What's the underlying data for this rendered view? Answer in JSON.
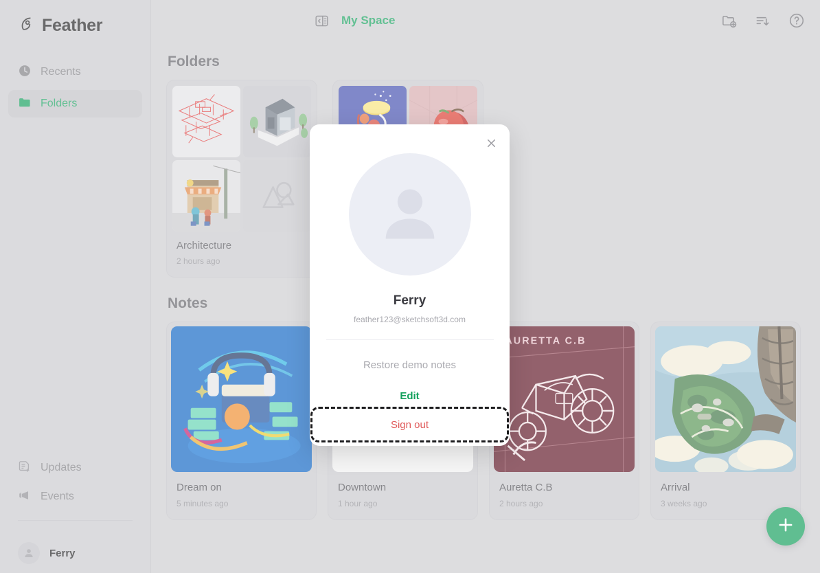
{
  "brand": {
    "name": "Feather",
    "logo_icon": "feather-icon"
  },
  "sidebar": {
    "items": [
      {
        "label": "Recents",
        "icon": "clock-icon",
        "active": false
      },
      {
        "label": "Folders",
        "icon": "folder-icon",
        "active": true
      }
    ],
    "bottom_items": [
      {
        "label": "Updates",
        "icon": "note-plus-icon"
      },
      {
        "label": "Events",
        "icon": "megaphone-icon"
      }
    ],
    "user": {
      "name": "Ferry",
      "avatar_icon": "person-icon"
    }
  },
  "topbar": {
    "collapse_icon": "panel-collapse-icon",
    "space_title": "My Space",
    "actions": [
      {
        "icon": "new-folder-icon",
        "name": "new-folder-button"
      },
      {
        "icon": "sort-icon",
        "name": "sort-button"
      },
      {
        "icon": "help-icon",
        "name": "help-button"
      }
    ]
  },
  "main": {
    "folders_heading": "Folders",
    "notes_heading": "Notes",
    "folders": [
      {
        "name": "Architecture",
        "time": "2 hours ago"
      },
      {
        "name": "",
        "time": ""
      }
    ],
    "notes": [
      {
        "name": "Dream on",
        "time": "5 minutes ago"
      },
      {
        "name": "Downtown",
        "time": "1 hour ago"
      },
      {
        "name": "Auretta C.B",
        "time": "2 hours ago"
      },
      {
        "name": "Arrival",
        "time": "3 weeks ago"
      }
    ],
    "fab": {
      "icon": "plus-icon",
      "label": "New"
    }
  },
  "modal": {
    "close_icon": "close-icon",
    "avatar_icon": "person-icon",
    "user_name": "Ferry",
    "email": "feather123@sketchsoft3d.com",
    "restore_label": "Restore demo notes",
    "edit_label": "Edit",
    "signout_label": "Sign out"
  },
  "colors": {
    "accent_green": "#13a05c",
    "fab_green": "#0f9d58",
    "danger_red": "#e05a5a",
    "app_bg": "#cbcbcf",
    "sidebar_bg": "#c9c9cd"
  }
}
